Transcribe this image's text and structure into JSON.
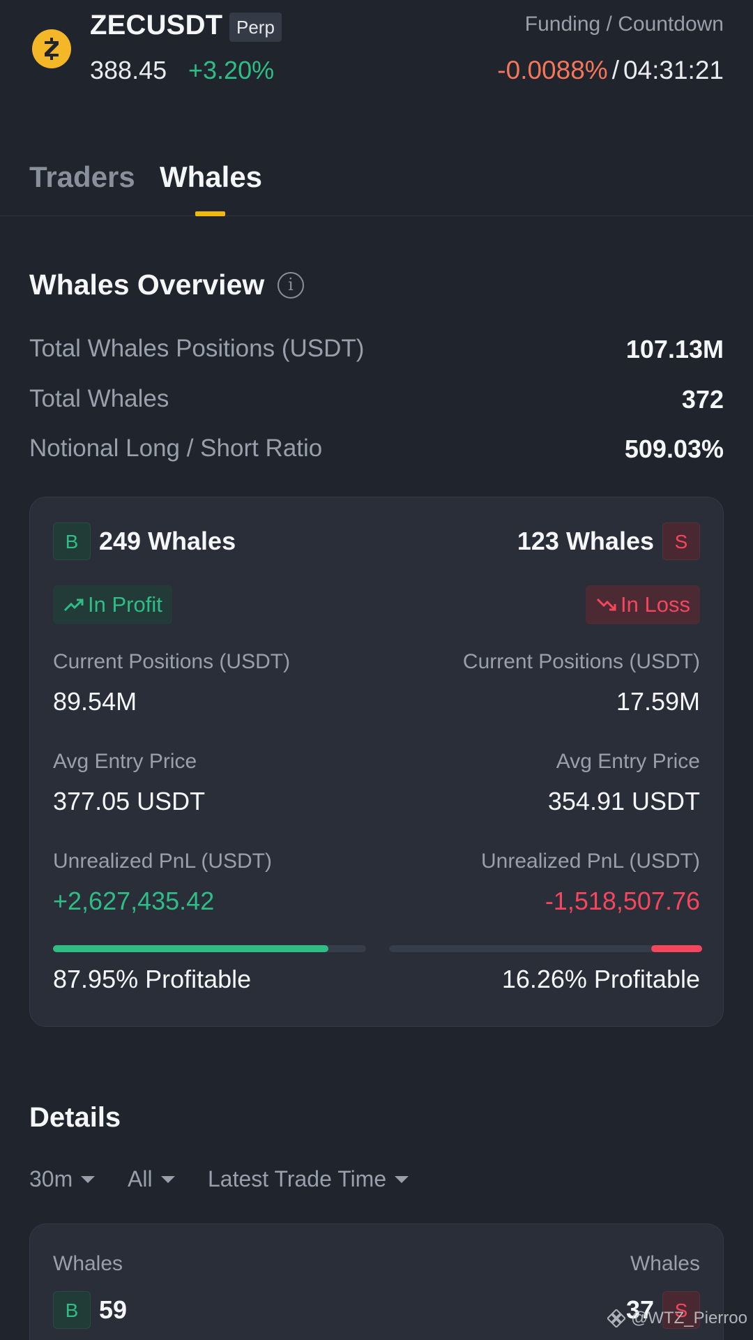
{
  "header": {
    "symbol": "ZECUSDT",
    "contract_tag": "Perp",
    "price": "388.45",
    "change": "+3.20%",
    "funding_label": "Funding / Countdown",
    "funding_rate": "-0.0088%",
    "separator": "/",
    "countdown": "04:31:21",
    "coin_icon": "zcash-coin-icon"
  },
  "tabs": [
    {
      "label": "Traders",
      "active": false
    },
    {
      "label": "Whales",
      "active": true
    }
  ],
  "overview": {
    "title": "Whales Overview",
    "info_icon": "i",
    "rows": [
      {
        "label": "Total Whales Positions (USDT)",
        "value": "107.13M"
      },
      {
        "label": "Total Whales",
        "value": "372"
      },
      {
        "label": "Notional Long / Short Ratio",
        "value": "509.03%"
      }
    ]
  },
  "long": {
    "badge": "B",
    "count": "249 Whales",
    "status": "In Profit",
    "positions_label": "Current Positions (USDT)",
    "positions_value": "89.54M",
    "avg_entry_label": "Avg Entry Price",
    "avg_entry_value": "377.05 USDT",
    "pnl_label": "Unrealized PnL (USDT)",
    "pnl_value": "+2,627,435.42",
    "profitable_text": "87.95% Profitable",
    "profitable_fraction": 0.8795
  },
  "short": {
    "badge": "S",
    "count": "123 Whales",
    "status": "In Loss",
    "positions_label": "Current Positions (USDT)",
    "positions_value": "17.59M",
    "avg_entry_label": "Avg Entry Price",
    "avg_entry_value": "354.91 USDT",
    "pnl_label": "Unrealized PnL (USDT)",
    "pnl_value": "-1,518,507.76",
    "profitable_text": "16.26% Profitable",
    "profitable_fraction": 0.1626
  },
  "details": {
    "title": "Details",
    "filters": [
      "30m",
      "All",
      "Latest Trade Time"
    ],
    "long_label": "Whales",
    "long_badge": "B",
    "long_count": "59",
    "short_label": "Whales",
    "short_badge": "S",
    "short_count": "37"
  },
  "watermark": "@WTZ_Pierroo",
  "colors": {
    "background": "#1f242d",
    "card": "#292e39",
    "positive": "#2ebd85",
    "negative": "#f6465d",
    "funding_negative": "#f6765a",
    "accent": "#f0b90b",
    "coin": "#f4b728"
  }
}
